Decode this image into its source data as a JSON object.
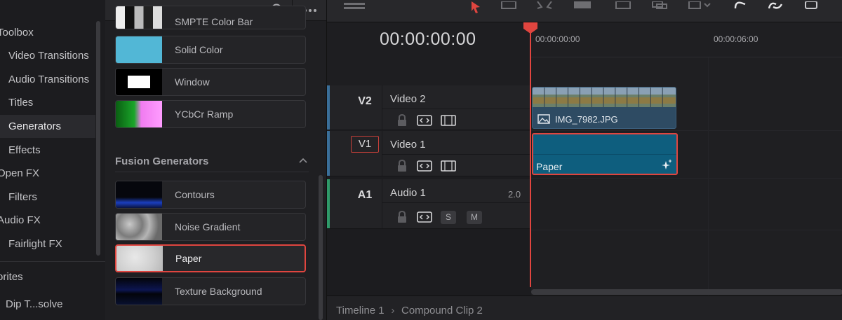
{
  "effects_library": {
    "categories": [
      {
        "label": "Toolbox",
        "level": 0
      },
      {
        "label": "Video Transitions",
        "level": 1
      },
      {
        "label": "Audio Transitions",
        "level": 1
      },
      {
        "label": "Titles",
        "level": 1
      },
      {
        "label": "Generators",
        "level": 1,
        "selected": true
      },
      {
        "label": "Effects",
        "level": 1
      },
      {
        "label": "Open FX",
        "level": 0
      },
      {
        "label": "Filters",
        "level": 1
      },
      {
        "label": "Audio FX",
        "level": 0
      },
      {
        "label": "Fairlight FX",
        "level": 1
      }
    ],
    "favorites_label": "orites",
    "favorites": [
      {
        "label": "Dip T...solve"
      }
    ]
  },
  "generators": {
    "items": [
      {
        "label": "SMPTE Color Bar",
        "thumb": "bars"
      },
      {
        "label": "Solid Color",
        "thumb": "solid"
      },
      {
        "label": "Window",
        "thumb": "window"
      },
      {
        "label": "YCbCr Ramp",
        "thumb": "ramp"
      }
    ],
    "fusion_section_title": "Fusion Generators",
    "fusion_items": [
      {
        "label": "Contours",
        "thumb": "contours"
      },
      {
        "label": "Noise Gradient",
        "thumb": "noise"
      },
      {
        "label": "Paper",
        "thumb": "paper",
        "selected": true
      },
      {
        "label": "Texture Background",
        "thumb": "texture"
      }
    ]
  },
  "timeline": {
    "timecode": "00:00:00:00",
    "ruler_labels": [
      "00:00:00:00",
      "00:00:06:00"
    ],
    "tracks": [
      {
        "id": "V2",
        "name": "Video 2",
        "type": "video"
      },
      {
        "id": "V1",
        "name": "Video 1",
        "type": "video",
        "target": true
      },
      {
        "id": "A1",
        "name": "Audio 1",
        "type": "audio",
        "volume": "2.0",
        "solo": "S",
        "mute": "M"
      }
    ],
    "clips": [
      {
        "label": "IMG_7982.JPG",
        "track": "V2"
      },
      {
        "label": "Paper",
        "track": "V1",
        "selected": true
      }
    ],
    "breadcrumb": [
      "Timeline 1",
      "Compound Clip 2"
    ]
  },
  "colors": {
    "accent_red": "#e0453f",
    "video_clip": "#2e4b63",
    "generator_clip": "#0e5e7e",
    "audio_stripe": "#2f9a6a",
    "video_stripe": "#3a6f9a"
  }
}
